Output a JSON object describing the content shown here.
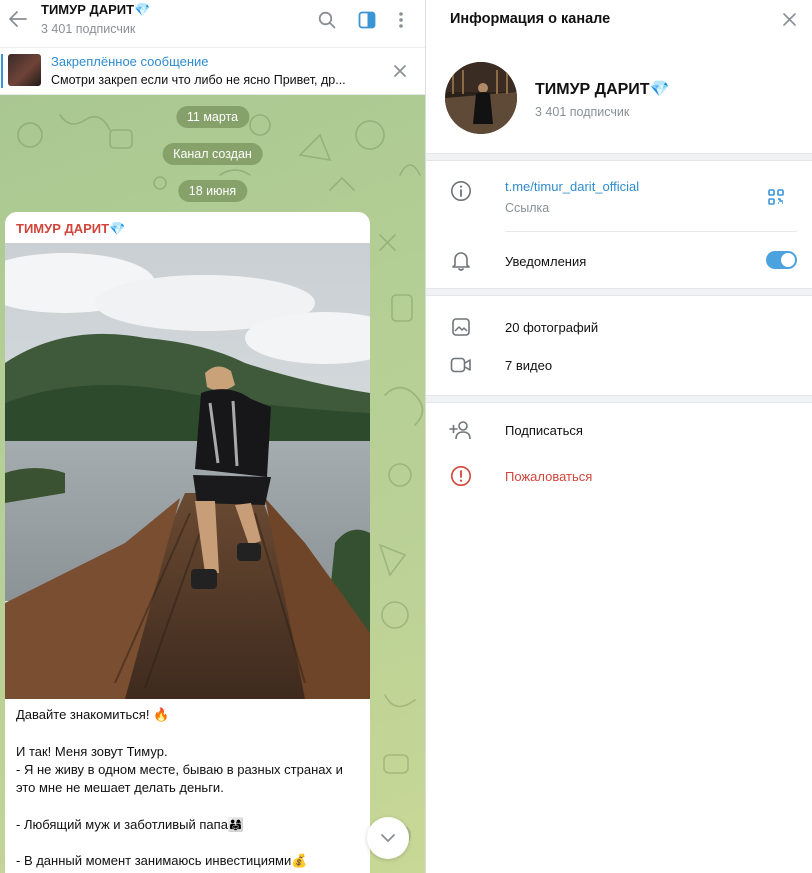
{
  "chat": {
    "header": {
      "title": "ТИМУР ДАРИТ💎",
      "subscribers": "3 401 подписчик"
    },
    "pinned": {
      "title": "Закреплённое сообщение",
      "text": "Смотри закреп если что либо не ясно  Привет, др..."
    },
    "dates": [
      "11 марта",
      "Канал создан",
      "18 июня"
    ],
    "message": {
      "author": "ТИМУР ДАРИТ💎",
      "lines": [
        "Давайте знакомиться! 🔥",
        "",
        "И так! Меня зовут Тимур.",
        "- Я не живу в одном месте, бываю в разных странах и",
        "это мне не мешает делать деньги.",
        "",
        "- Любящий муж и заботливый папа👨‍👩‍👧",
        "",
        "- В данный момент занимаюсь инвестициями💰"
      ]
    }
  },
  "info": {
    "title": "Информация о канале",
    "channel_name": "ТИМУР ДАРИТ💎",
    "subscribers": "3 401 подписчик",
    "link": "t.me/timur_darit_official",
    "link_caption": "Ссылка",
    "notifications_label": "Уведомления",
    "notifications_on": true,
    "photos_label": "20 фотографий",
    "videos_label": "7 видео",
    "subscribe_label": "Подписаться",
    "report_label": "Пожаловаться"
  },
  "colors": {
    "accent": "#2f8ccf",
    "danger": "#d1453b",
    "toggle": "#4aa3df"
  }
}
